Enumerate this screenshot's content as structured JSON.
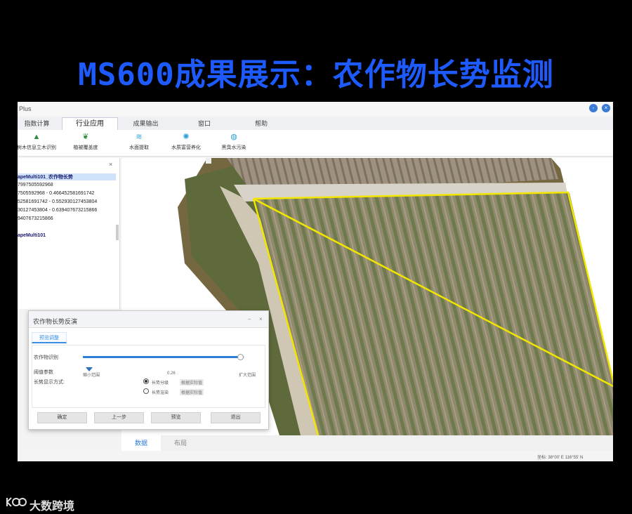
{
  "slide_title": "MS600成果展示：农作物长势监测",
  "app": {
    "title": "Plus",
    "window_controls": [
      "-",
      "×"
    ],
    "menu_tabs": [
      "指数计算",
      "行业应用",
      "成果输出",
      "窗口",
      "帮助"
    ],
    "active_tab": "行业应用",
    "tools": [
      {
        "label": "树木信息立木识别",
        "icon": "tree-icon"
      },
      {
        "label": "植被覆盖度",
        "icon": "plant-icon"
      },
      {
        "label": "水面提取",
        "icon": "water-icon"
      },
      {
        "label": "水质富营养化",
        "icon": "water-quality-icon"
      },
      {
        "label": "黑臭水污染",
        "icon": "pollution-icon"
      }
    ],
    "layer_panel": {
      "close": "×",
      "lines": [
        "apeMulti101_农作物长势",
        "7997505592968",
        "7505592968 - 0.466452581691742",
        "52581691742 - 0.552930127453804",
        "30127453804 - 0.639407673215866",
        "9407673215866",
        "apeMulti101"
      ]
    },
    "dialog": {
      "title": "农作物长势反演",
      "controls": [
        "‒",
        "×"
      ],
      "tab": "预览调整",
      "fields": {
        "range_label": "农作物识别",
        "param_label": "阈值参数",
        "display_label": "长势显示方式:"
      },
      "slider": {
        "min_label": "缩小范围",
        "value_label": "0.26",
        "max_label": "扩大范围",
        "fill_fraction": 0.98
      },
      "radios": [
        {
          "label": "长势分级",
          "extra": "根据实际值",
          "checked": true
        },
        {
          "label": "长势渲染",
          "extra": "根据实际值",
          "checked": false
        }
      ],
      "buttons": [
        "确定",
        "上一步",
        "预览",
        "退出"
      ]
    },
    "bottom_tabs": [
      "数据",
      "布局"
    ],
    "status": "坐标: 38°00' E 116°55' N",
    "colors": {
      "field_outline": "#f2e600",
      "accent": "#2f7fd6",
      "title_blue": "#1e5bff"
    }
  },
  "watermark": "大数跨境"
}
